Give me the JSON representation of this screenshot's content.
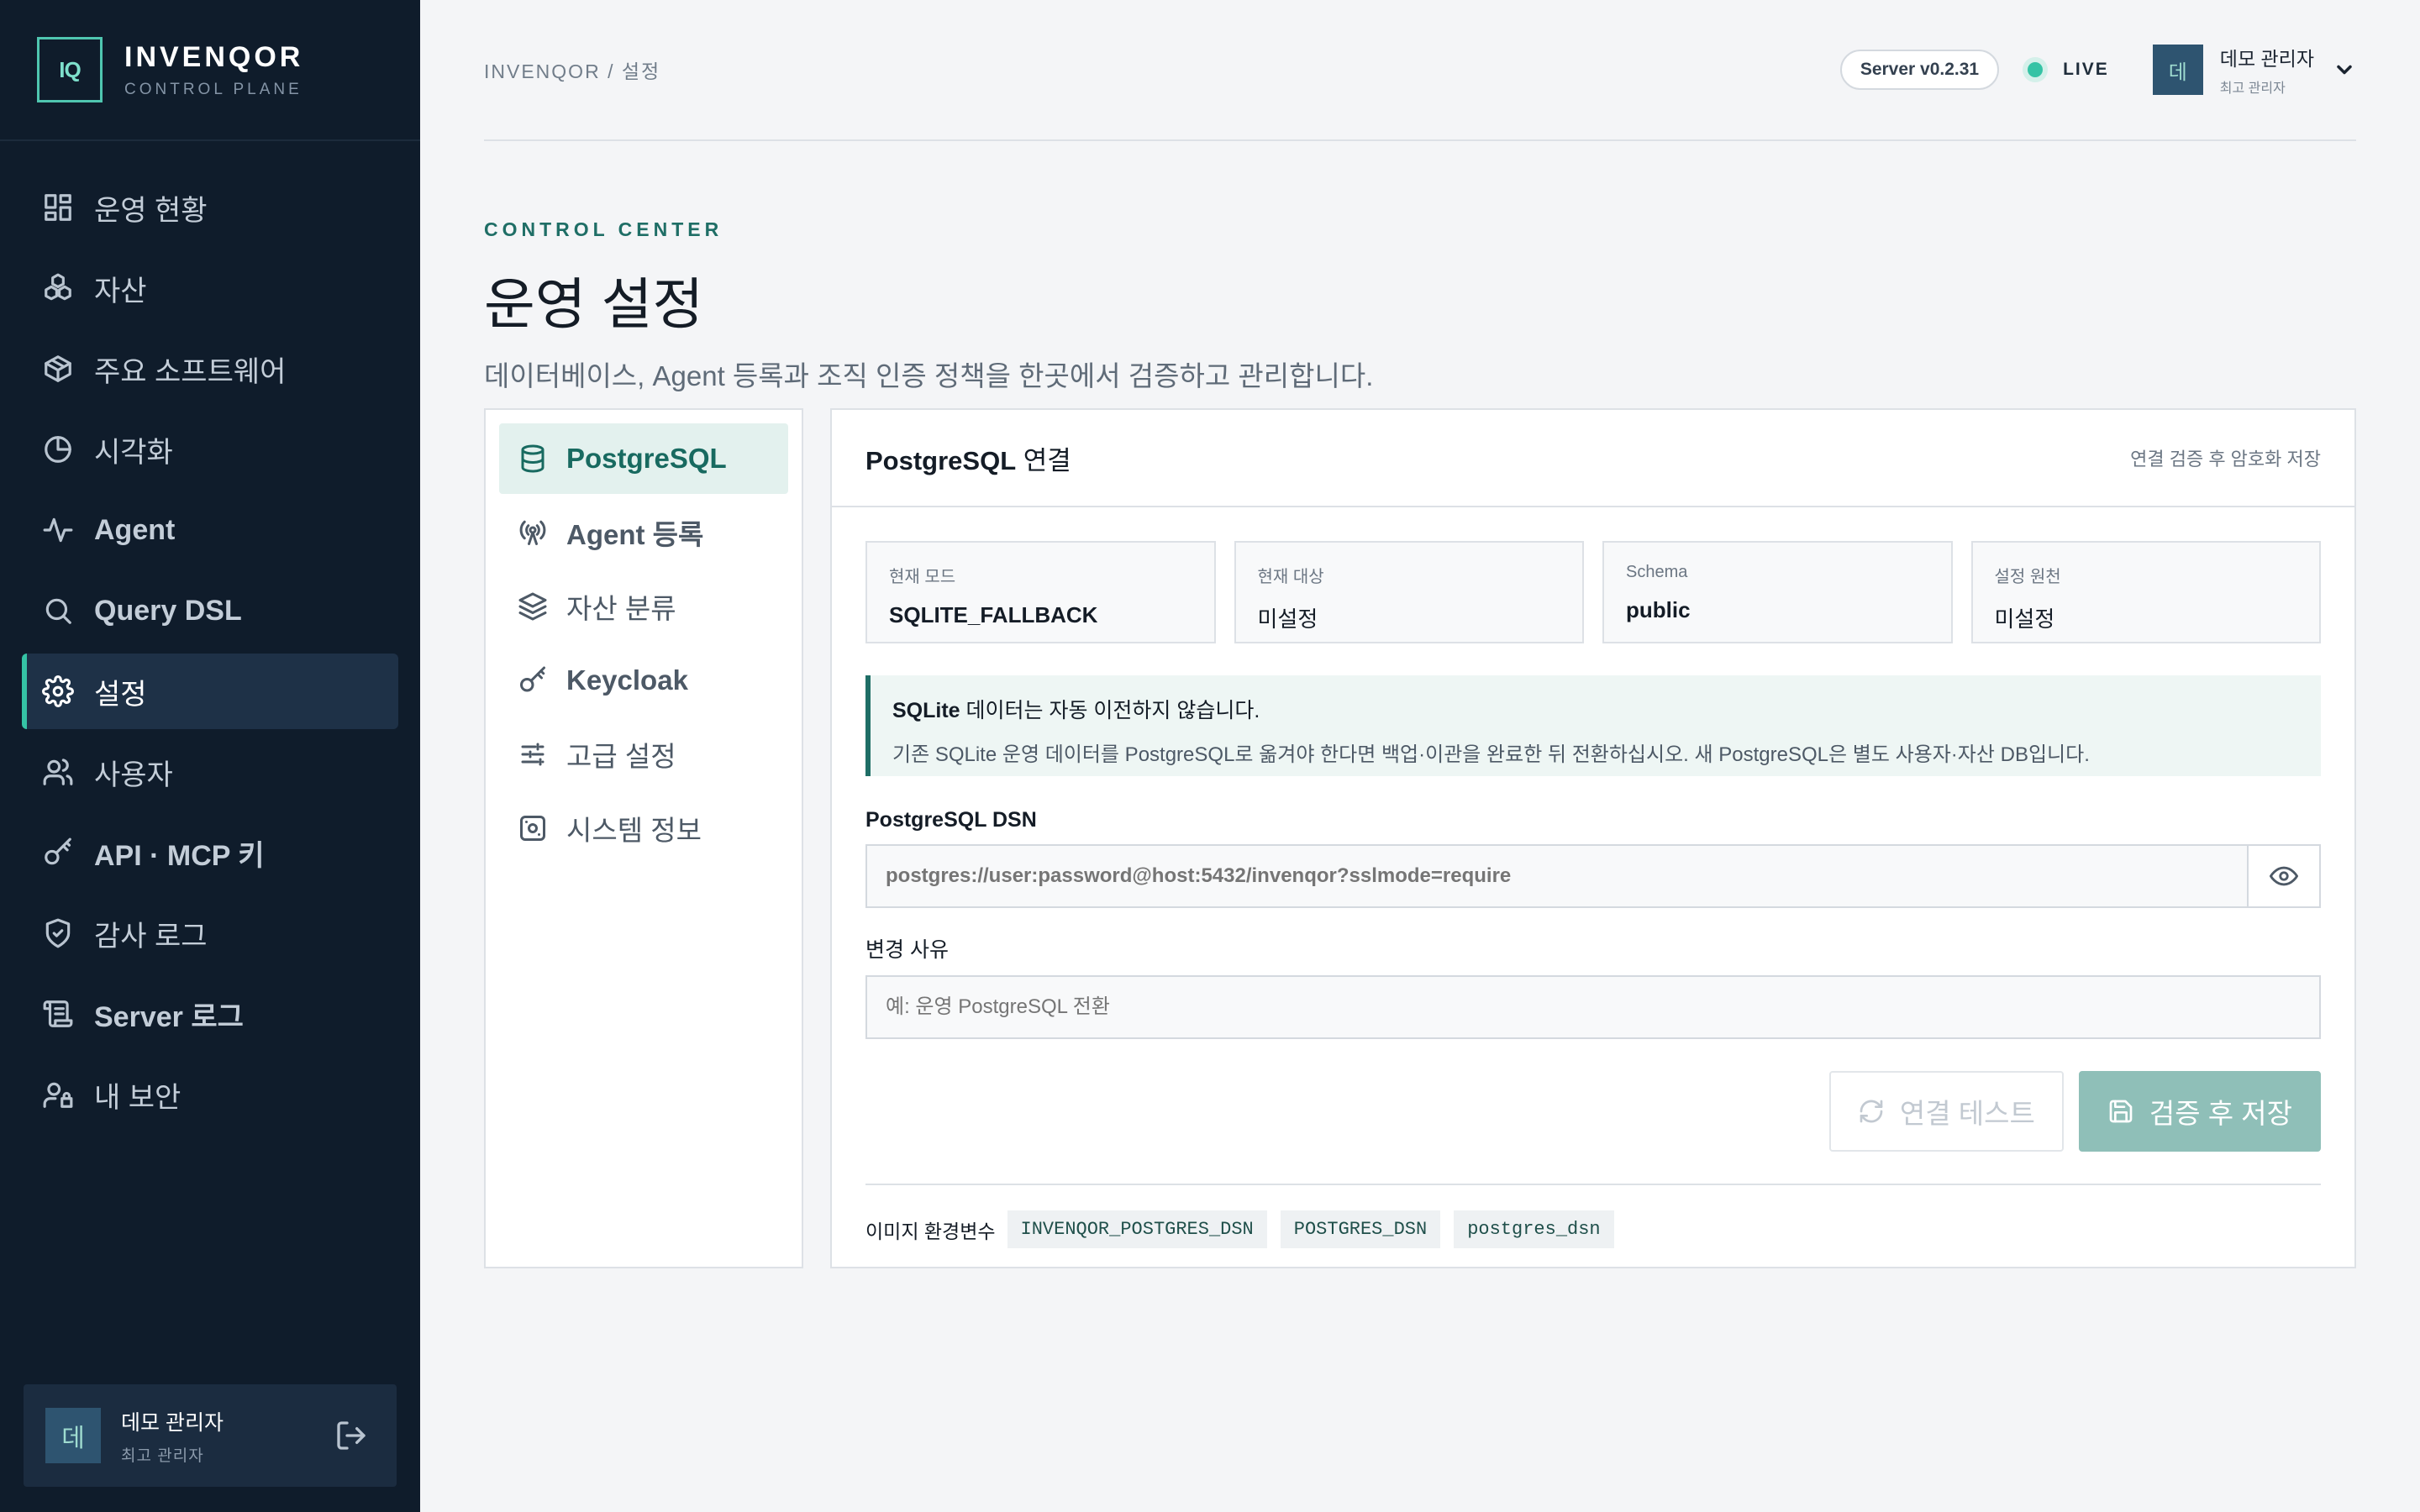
{
  "brand": {
    "logo": "IQ",
    "name": "INVENQOR",
    "sub": "CONTROL PLANE"
  },
  "sidebar": {
    "items": [
      {
        "label": "운영 현황",
        "icon": "dashboard-icon"
      },
      {
        "label": "자산",
        "icon": "assets-icon"
      },
      {
        "label": "주요 소프트웨어",
        "icon": "package-icon"
      },
      {
        "label": "시각화",
        "icon": "chart-icon"
      },
      {
        "label": "Agent",
        "icon": "activity-icon"
      },
      {
        "label": "Query DSL",
        "icon": "search-icon"
      },
      {
        "label": "설정",
        "icon": "gear-icon",
        "active": true
      },
      {
        "label": "사용자",
        "icon": "users-icon"
      },
      {
        "label": "API · MCP 키",
        "icon": "key-icon"
      },
      {
        "label": "감사 로그",
        "icon": "shield-check-icon"
      },
      {
        "label": "Server 로그",
        "icon": "scroll-icon"
      },
      {
        "label": "내 보안",
        "icon": "user-lock-icon"
      }
    ],
    "user": {
      "avatar": "데",
      "name": "데모 관리자",
      "role": "최고 관리자"
    }
  },
  "topbar": {
    "breadcrumb": "INVENQOR / 설정",
    "version": "Server v0.2.31",
    "status": "LIVE",
    "user": {
      "avatar": "데",
      "name": "데모 관리자",
      "role": "최고 관리자"
    }
  },
  "page": {
    "eyebrow": "CONTROL CENTER",
    "title": "운영 설정",
    "description": "데이터베이스, Agent 등록과 조직 인증 정책을 한곳에서 검증하고 관리합니다."
  },
  "subnav": [
    {
      "label": "PostgreSQL",
      "icon": "database-icon",
      "active": true
    },
    {
      "label": "Agent 등록",
      "icon": "antenna-icon"
    },
    {
      "label": "자산 분류",
      "icon": "layers-icon"
    },
    {
      "label": "Keycloak",
      "icon": "key-icon"
    },
    {
      "label": "고급 설정",
      "icon": "sliders-icon"
    },
    {
      "label": "시스템 정보",
      "icon": "system-icon"
    }
  ],
  "panel": {
    "title_strong": "PostgreSQL",
    "title_rest": " 연결",
    "note": "연결 검증 후 암호화 저장",
    "stats": [
      {
        "label": "현재 모드",
        "value": "SQLITE_FALLBACK"
      },
      {
        "label": "현재 대상",
        "value": "미설정"
      },
      {
        "label": "Schema",
        "value": "public"
      },
      {
        "label": "설정 원천",
        "value": "미설정"
      }
    ],
    "alert": {
      "title_strong": "SQLite",
      "title_rest": " 데이터는 자동 이전하지 않습니다.",
      "text": "기존 SQLite 운영 데이터를 PostgreSQL로 옮겨야 한다면 백업·이관을 완료한 뒤 전환하십시오. 새 PostgreSQL은 별도 사용자·자산 DB입니다."
    },
    "dsn": {
      "label": "PostgreSQL DSN",
      "placeholder": "postgres://user:password@host:5432/invenqor?sslmode=require",
      "value": ""
    },
    "reason": {
      "label": "변경 사유",
      "placeholder": "예: 운영 PostgreSQL 전환",
      "value": ""
    },
    "buttons": {
      "test": "연결 테스트",
      "save": "검증 후 저장"
    },
    "env": {
      "label": "이미지 환경변수",
      "vars": [
        "INVENQOR_POSTGRES_DSN",
        "POSTGRES_DSN",
        "postgres_dsn"
      ]
    }
  },
  "colors": {
    "sidebar_bg": "#0f1c2b",
    "accent": "#35c3a5",
    "accent_dark": "#1f6e66",
    "save_button": "#8fbfb8"
  }
}
